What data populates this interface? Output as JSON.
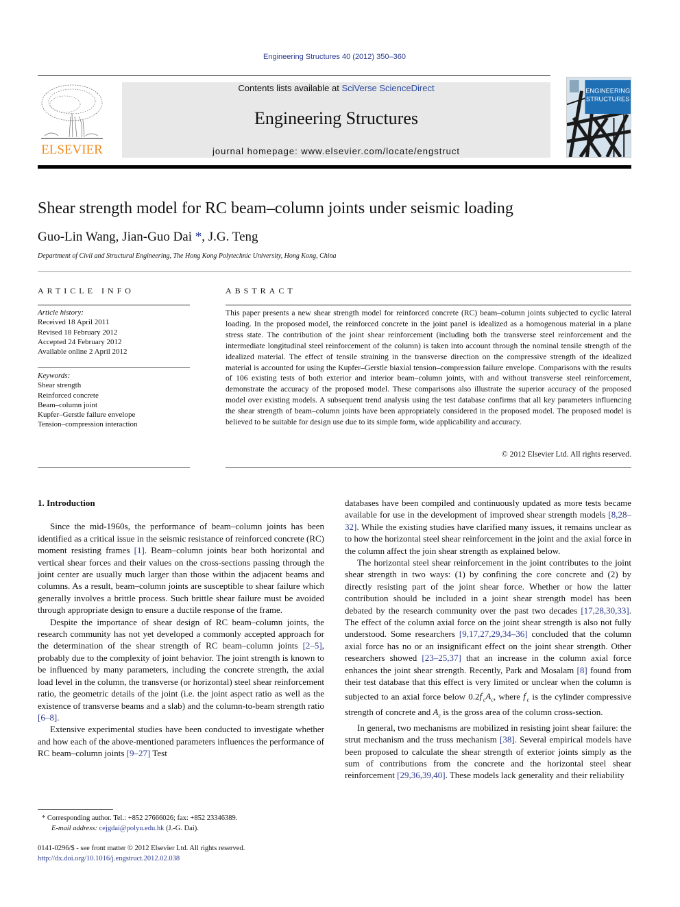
{
  "header": {
    "citation": "Engineering Structures 40 (2012) 350–360",
    "contents_prefix": "Contents lists available at ",
    "contents_link": "SciVerse ScienceDirect",
    "journal_name": "Engineering Structures",
    "homepage": "journal homepage: www.elsevier.com/locate/engstruct",
    "publisher_logo_text": "ELSEVIER",
    "cover_title_line1": "ENGINEERING",
    "cover_title_line2": "STRUCTURES"
  },
  "colors": {
    "link": "#2b3a8f",
    "elsevier_orange": "#f08a1c",
    "masthead_gray": "#e8e8e8",
    "cover_blue": "#1f6fb5"
  },
  "article": {
    "title": "Shear strength model for RC beam–column joints under seismic loading",
    "authors_part1": "Guo-Lin Wang, Jian-Guo Dai ",
    "corresponding_mark": "*",
    "authors_part2": ", J.G. Teng",
    "affiliation": "Department of Civil and Structural Engineering, The Hong Kong Polytechnic University, Hong Kong, China"
  },
  "article_info": {
    "heading": "ARTICLE INFO",
    "history_label": "Article history:",
    "history": [
      "Received 18 April 2011",
      "Revised 18 February 2012",
      "Accepted 24 February 2012",
      "Available online 2 April 2012"
    ],
    "keywords_label": "Keywords:",
    "keywords": [
      "Shear strength",
      "Reinforced concrete",
      "Beam–column joint",
      "Kupfer–Gerstle failure envelope",
      "Tension–compression interaction"
    ]
  },
  "abstract": {
    "heading": "ABSTRACT",
    "text": "This paper presents a new shear strength model for reinforced concrete (RC) beam–column joints subjected to cyclic lateral loading. In the proposed model, the reinforced concrete in the joint panel is idealized as a homogenous material in a plane stress state. The contribution of the joint shear reinforcement (including both the transverse steel reinforcement and the intermediate longitudinal steel reinforcement of the column) is taken into account through the nominal tensile strength of the idealized material. The effect of tensile straining in the transverse direction on the compressive strength of the idealized material is accounted for using the Kupfer–Gerstle biaxial tension–compression failure envelope. Comparisons with the results of 106 existing tests of both exterior and interior beam–column joints, with and without transverse steel reinforcement, demonstrate the accuracy of the proposed model. These comparisons also illustrate the superior accuracy of the proposed model over existing models. A subsequent trend analysis using the test database confirms that all key parameters influencing the shear strength of beam–column joints have been appropriately considered in the proposed model. The proposed model is believed to be suitable for design use due to its simple form, wide applicability and accuracy.",
    "copyright": "© 2012 Elsevier Ltd. All rights reserved."
  },
  "body": {
    "section_heading": "1. Introduction",
    "p1": {
      "a": "Since the mid-1960s, the performance of beam–column joints has been identified as a critical issue in the seismic resistance of reinforced concrete (RC) moment resisting frames ",
      "ref1": "[1]",
      "b": ". Beam–column joints bear both horizontal and vertical shear forces and their values on the cross-sections passing through the joint center are usually much larger than those within the adjacent beams and columns. As a result, beam–column joints are susceptible to shear failure which generally involves a brittle process. Such brittle shear failure must be avoided through appropriate design to ensure a ductile response of the frame."
    },
    "p2": {
      "a": "Despite the importance of shear design of RC beam–column joints, the research community has not yet developed a commonly accepted approach for the determination of the shear strength of RC beam–column joints ",
      "ref1": "[2–5]",
      "b": ", probably due to the complexity of joint behavior. The joint strength is known to be influenced by many parameters, including the concrete strength, the axial load level in the column, the transverse (or horizontal) steel shear reinforcement ratio, the geometric details of the joint (i.e. the joint aspect ratio as well as the existence of transverse beams and a slab) and the column-to-beam strength ratio ",
      "ref2": "[6–8]",
      "c": "."
    },
    "p3": {
      "a": "Extensive experimental studies have been conducted to investigate whether and how each of the above-mentioned parameters influences the performance of RC beam–column joints ",
      "ref1": "[9–27]",
      "b": ". Test databases have been compiled and continuously updated as more tests became available for use in the development of improved shear strength models ",
      "ref2": "[8,28–32]",
      "c": ". While the existing studies have clarified many issues, it remains unclear as to how the horizontal steel shear reinforcement in the joint and the axial force in the column affect the join shear strength as explained below."
    },
    "p4": {
      "a": "The horizontal steel shear reinforcement in the joint contributes to the joint shear strength in two ways: (1) by confining the core concrete and (2) by directly resisting part of the joint shear force. Whether or how the latter contribution should be included in a joint shear strength model has been debated by the research community over the past two decades ",
      "ref1": "[17,28,30,33]",
      "b": ". The effect of the column axial force on the joint shear strength is also not fully understood. Some researchers ",
      "ref2": "[9,17,27,29,34–36]",
      "c": " concluded that the column axial force has no or an insignificant effect on the joint shear strength. Other researchers showed ",
      "ref3": "[23–25,37]",
      "d": " that an increase in the column axial force enhances the joint shear strength. Recently, Park and Mosalam ",
      "ref4": "[8]",
      "e": " found from their test database that this effect is very limited or unclear when the column is subjected to an axial force below 0.2",
      "math1_f": "f",
      "math1_sub": "c",
      "math1_sup": "′",
      "math1_A": "A",
      "math1_Asub": "c",
      "f": ", where ",
      "g": " is the cylinder compressive strength of concrete and ",
      "h": " is the gross area of the column cross-section."
    },
    "p5": {
      "a": "In general, two mechanisms are mobilized in resisting joint shear failure: the strut mechanism and the truss mechanism ",
      "ref1": "[38]",
      "b": ". Several empirical models have been proposed to calculate the shear strength of exterior joints simply as the sum of contributions from the concrete and the horizontal steel shear reinforcement ",
      "ref2": "[29,36,39,40]",
      "c": ". These models lack generality and their reliability"
    }
  },
  "footnote": {
    "mark": "*",
    "corresponding": " Corresponding author. Tel.: +852 27666026; fax: +852 23346389.",
    "email_label": "E-mail address:",
    "email": "cejgdai@polyu.edu.hk",
    "email_suffix": " (J.-G. Dai)."
  },
  "front_matter": {
    "issn_line": "0141-0296/$ - see front matter © 2012 Elsevier Ltd. All rights reserved.",
    "doi": "http://dx.doi.org/10.1016/j.engstruct.2012.02.038"
  }
}
